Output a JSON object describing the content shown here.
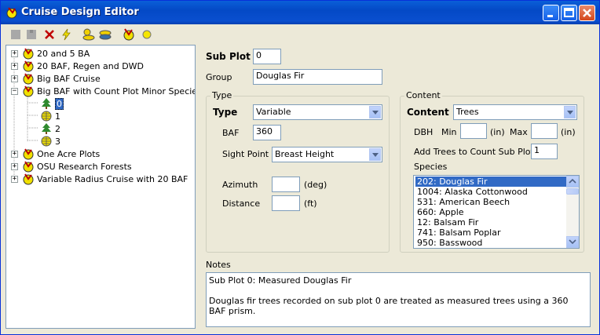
{
  "window": {
    "title": "Cruise Design Editor"
  },
  "toolbar": {
    "icons": [
      "save-icon",
      "save-all-icon",
      "delete-icon",
      "lightning-icon",
      "add-plot-icon",
      "add-subplot-icon",
      "cruise-icon",
      "yellow-dot-icon"
    ]
  },
  "tree": {
    "items": [
      {
        "label": "20 and 5 BA",
        "expander": "+"
      },
      {
        "label": "20 BAF, Regen and DWD",
        "expander": "+"
      },
      {
        "label": "Big BAF Cruise",
        "expander": "+"
      },
      {
        "label": "Big BAF with Count Plot Minor Species",
        "expander": "−"
      },
      {
        "label": "0",
        "selected": true
      },
      {
        "label": "1"
      },
      {
        "label": "2"
      },
      {
        "label": "3"
      },
      {
        "label": "One Acre Plots",
        "expander": "+"
      },
      {
        "label": "OSU Research Forests",
        "expander": "+"
      },
      {
        "label": "Variable Radius Cruise with 20 BAF",
        "expander": "+"
      }
    ]
  },
  "form": {
    "subplot_label": "Sub Plot",
    "subplot_value": "0",
    "group_label": "Group",
    "group_value": "Douglas Fir",
    "type_group": {
      "title": "Type",
      "type_label": "Type",
      "type_value": "Variable",
      "baf_label": "BAF",
      "baf_value": "360",
      "sight_label": "Sight Point",
      "sight_value": "Breast Height",
      "azimuth_label": "Azimuth",
      "azimuth_value": "",
      "azimuth_unit": "(deg)",
      "distance_label": "Distance",
      "distance_value": "",
      "distance_unit": "(ft)"
    },
    "content_group": {
      "title": "Content",
      "content_label": "Content",
      "content_value": "Trees",
      "dbh_label": "DBH",
      "min_label": "Min",
      "min_value": "",
      "min_unit": "(in)",
      "max_label": "Max",
      "max_value": "",
      "max_unit": "(in)",
      "add_trees_label": "Add Trees to Count Sub Plot",
      "add_trees_value": "1",
      "species_label": "Species",
      "species": [
        "202: Douglas Fir",
        "1004: Alaska Cottonwood",
        "531: American Beech",
        "660: Apple",
        "12: Balsam Fir",
        "741: Balsam Poplar",
        "950: Basswood"
      ]
    },
    "notes_label": "Notes",
    "notes_line1": "Sub Plot 0: Measured Douglas Fir",
    "notes_line2": "Douglas fir trees recorded on sub plot 0 are treated as measured trees using a 360 BAF prism."
  },
  "colors": {
    "titlebar": "#0a5fd8",
    "selection": "#316ac5",
    "window_bg": "#ece9d8"
  }
}
